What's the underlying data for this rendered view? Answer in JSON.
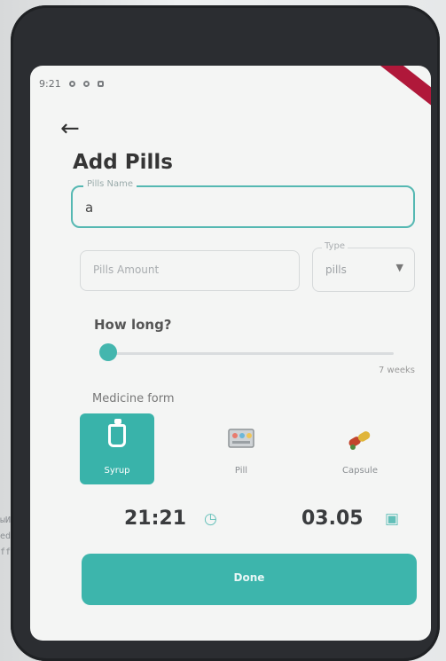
{
  "status_bar": {
    "time": "9:21"
  },
  "page": {
    "title": "Add Pills"
  },
  "form": {
    "name_field": {
      "label": "Pills Name",
      "value": "a"
    },
    "amount_field": {
      "placeholder": "Pills Amount"
    },
    "type_field": {
      "label": "Type",
      "value": "pills"
    },
    "how_long_label": "How long?",
    "duration_value_label": "7 weeks",
    "duration_fraction": 0.0,
    "medicine_form_label": "Medicine form",
    "medicine_forms": [
      {
        "label": "Syrup",
        "selected": true,
        "icon": "syrup-bottle-icon"
      },
      {
        "label": "Pill",
        "selected": false,
        "icon": "pill-box-icon"
      },
      {
        "label": "Capsule",
        "selected": false,
        "icon": "capsule-icon"
      }
    ],
    "time": "21:21",
    "date": "03.05",
    "done_label": "Done"
  },
  "colors": {
    "accent": "#3db5ac",
    "title": "#353535",
    "background": "#f4f5f4"
  }
}
